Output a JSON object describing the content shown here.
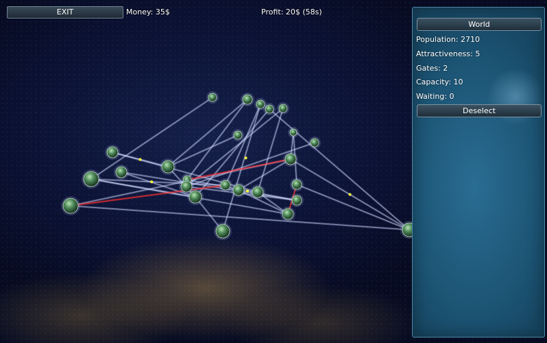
{
  "top_bar": {
    "exit_label": "EXIT",
    "money_text": "Money: 35$",
    "profit_text": "Profit: 20$ (58s)"
  },
  "panel": {
    "title": "World",
    "stats": [
      "Population: 2710",
      "Attractiveness: 5",
      "Gates: 2",
      "Capacity: 10",
      "Waiting: 0"
    ],
    "deselect_label": "Deselect"
  },
  "colors": {
    "route": "#cfd8ff",
    "route_alert": "#ff3030",
    "cargo": "#ffff33",
    "planet": "#4f8a5a",
    "panel": "#1f5a7c"
  }
}
